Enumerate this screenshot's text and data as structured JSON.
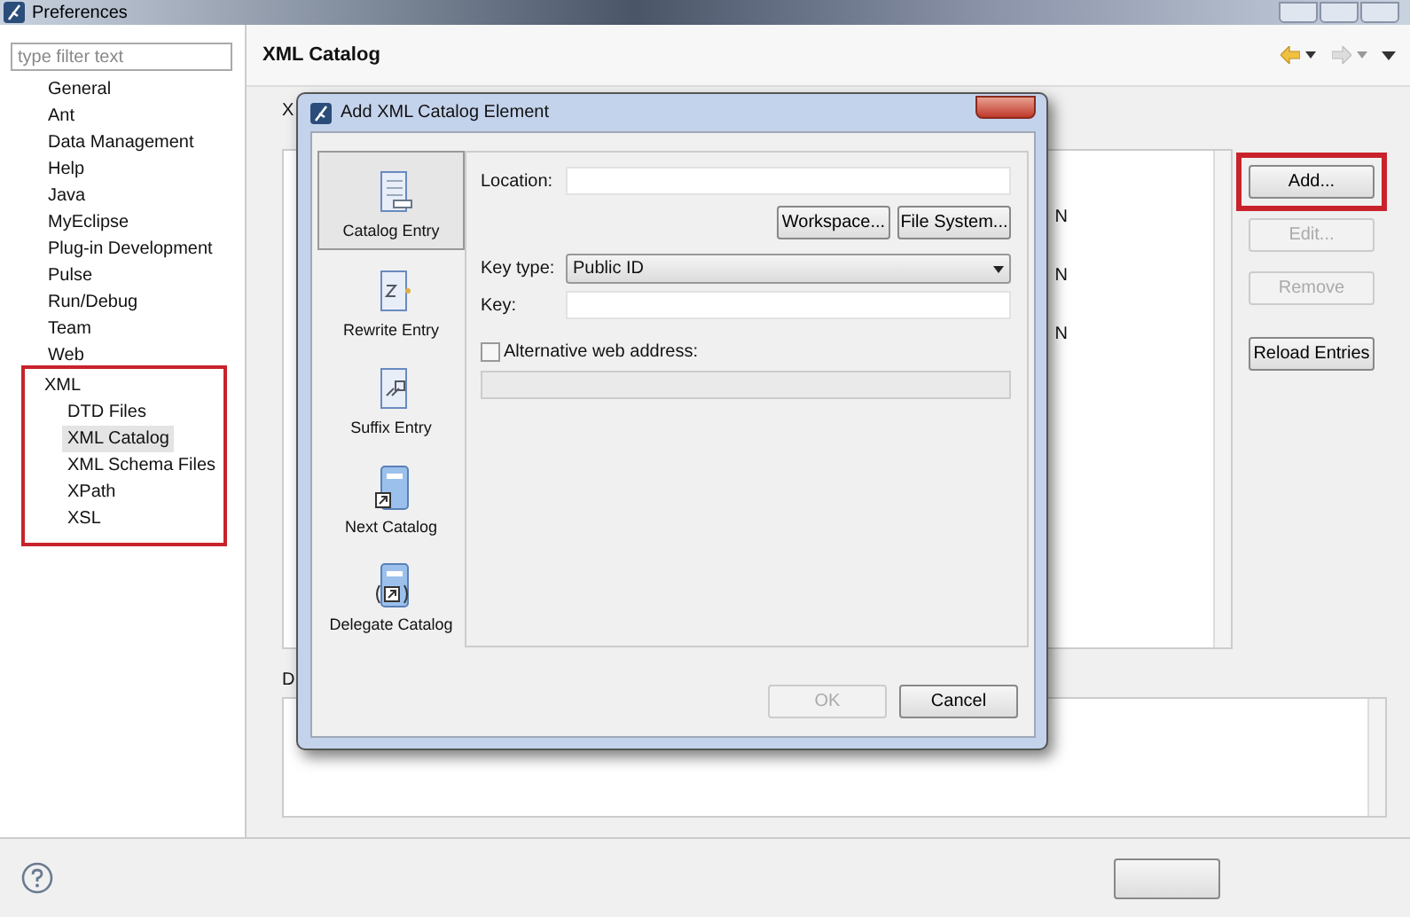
{
  "window": {
    "title": "Preferences"
  },
  "sidebar": {
    "filter": {
      "placeholder": "type filter text"
    },
    "items": [
      {
        "label": "General",
        "selected": false
      },
      {
        "label": "Ant",
        "selected": false
      },
      {
        "label": "Data Management",
        "selected": false
      },
      {
        "label": "Help",
        "selected": false
      },
      {
        "label": "Java",
        "selected": false
      },
      {
        "label": "MyEclipse",
        "selected": false
      },
      {
        "label": "Plug-in Development",
        "selected": false
      },
      {
        "label": "Pulse",
        "selected": false
      },
      {
        "label": "Run/Debug",
        "selected": false
      },
      {
        "label": "Team",
        "selected": false
      },
      {
        "label": "Web",
        "selected": false
      },
      {
        "label": "XML",
        "selected": false,
        "highlighted": true,
        "children": [
          {
            "label": "DTD Files",
            "selected": false
          },
          {
            "label": "XML Catalog",
            "selected": true
          },
          {
            "label": "XML Schema Files",
            "selected": false
          },
          {
            "label": "XPath",
            "selected": false
          },
          {
            "label": "XSL",
            "selected": false
          }
        ]
      }
    ]
  },
  "page": {
    "title": "XML Catalog",
    "entries_label": "X",
    "details_label": "D",
    "column_fragments": [
      "N",
      "N",
      "N"
    ],
    "buttons": [
      {
        "label": "Add...",
        "disabled": false,
        "highlighted": true
      },
      {
        "label": "Edit...",
        "disabled": true
      },
      {
        "label": "Remove",
        "disabled": true
      },
      {
        "label": "Reload Entries",
        "disabled": false
      }
    ]
  },
  "dialog": {
    "title": "Add XML Catalog Element",
    "entries": [
      {
        "label": "Catalog Entry",
        "selected": true,
        "kind": "catalog"
      },
      {
        "label": "Rewrite Entry",
        "selected": false,
        "kind": "rewrite"
      },
      {
        "label": "Suffix Entry",
        "selected": false,
        "kind": "suffix"
      },
      {
        "label": "Next Catalog",
        "selected": false,
        "kind": "next"
      },
      {
        "label": "Delegate Catalog",
        "selected": false,
        "kind": "delegate"
      }
    ],
    "location": {
      "label": "Location:"
    },
    "browse_buttons": [
      "Workspace...",
      "File System..."
    ],
    "key_type": {
      "label": "Key type:",
      "value": "Public ID"
    },
    "key": {
      "label": "Key:"
    },
    "alternative": {
      "label": "Alternative web address:",
      "checked": false
    },
    "buttons": [
      {
        "label": "OK",
        "disabled": true
      },
      {
        "label": "Cancel",
        "disabled": false
      }
    ]
  }
}
